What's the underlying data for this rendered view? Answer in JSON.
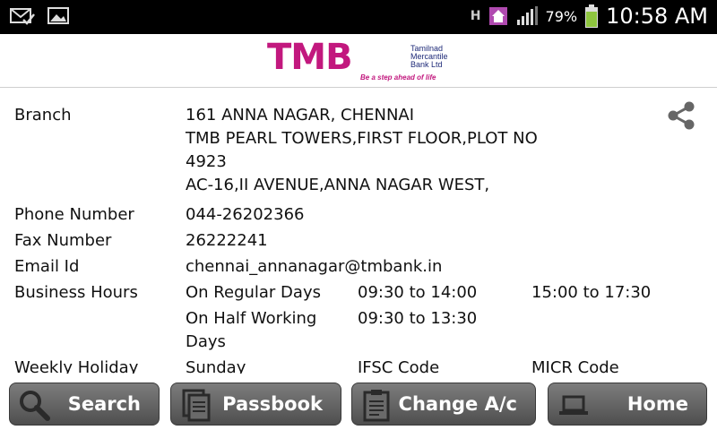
{
  "status_bar": {
    "network": "H",
    "battery": "79%",
    "time": "10:58 AM"
  },
  "header": {
    "logo_text": "TMB",
    "logo_side": [
      "Tamilnad",
      "Mercantile",
      "Bank Ltd"
    ],
    "tagline": "Be a step ahead of life"
  },
  "branch": {
    "branch_label": "Branch",
    "address_lines": [
      "161  ANNA NAGAR,  CHENNAI",
      "TMB PEARL TOWERS,FIRST FLOOR,PLOT NO",
      "4923",
      "AC-16,II AVENUE,ANNA NAGAR WEST,"
    ],
    "phone_label": "Phone Number",
    "phone": "044-26202366",
    "fax_label": "Fax Number",
    "fax": "26222241",
    "email_label": "Email Id",
    "email": "chennai_annanagar@tmbank.in",
    "hours_label": "Business Hours",
    "regular_label": "On Regular Days",
    "regular_1": "09:30 to 14:00",
    "regular_2": "15:00 to 17:30",
    "half_label_1": "On Half Working",
    "half_label_2": "Days",
    "half_1": "09:30 to 13:30",
    "holiday_label": "Weekly Holiday",
    "holiday": "Sunday",
    "ifsc_label": "IFSC Code",
    "micr_label": "MICR Code"
  },
  "bottom_nav": {
    "search": "Search",
    "passbook": "Passbook",
    "change": "Change A/c",
    "home": "Home"
  },
  "colors": {
    "brand": "#c2187e",
    "brand_secondary": "#1e2a78",
    "button": "#666666"
  }
}
